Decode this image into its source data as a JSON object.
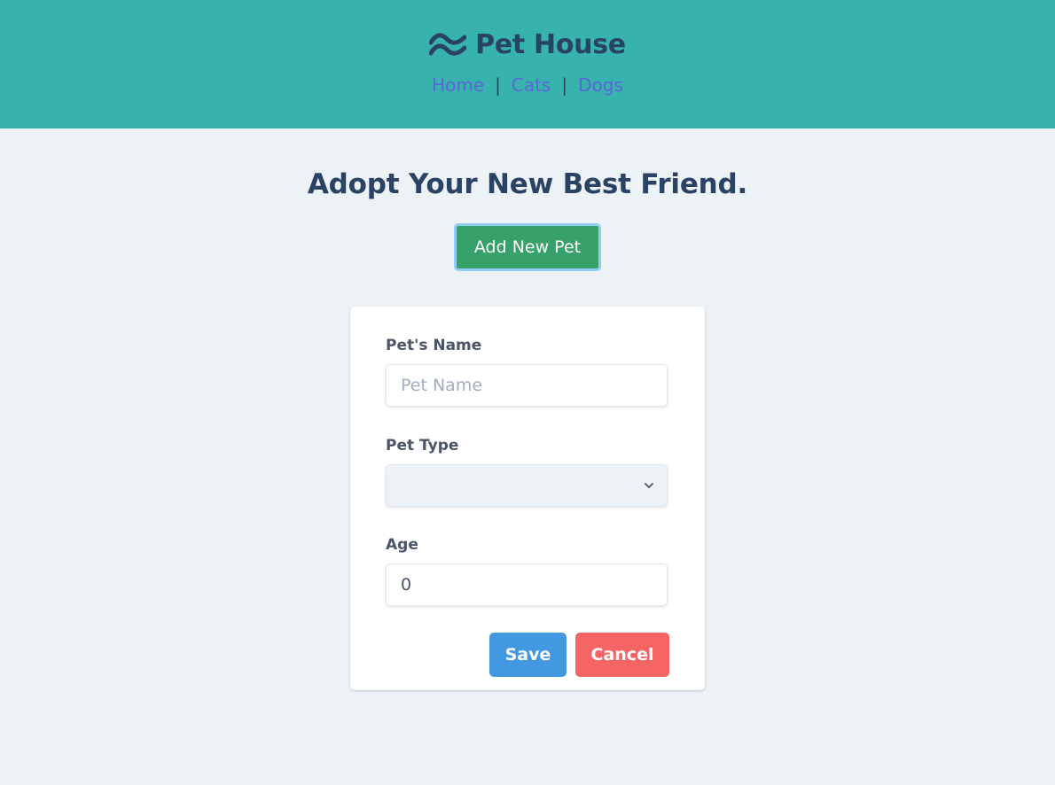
{
  "header": {
    "title": "Pet House",
    "icon": "tailwind-wave-icon",
    "nav": {
      "home": "Home",
      "cats": "Cats",
      "dogs": "Dogs",
      "separator": "|"
    }
  },
  "main": {
    "heading": "Adopt Your New Best Friend.",
    "add_button": "Add New Pet"
  },
  "form": {
    "name_label": "Pet's Name",
    "name_placeholder": "Pet Name",
    "name_value": "",
    "type_label": "Pet Type",
    "type_value": "",
    "age_label": "Age",
    "age_value": "0",
    "save_label": "Save",
    "cancel_label": "Cancel"
  },
  "colors": {
    "header_bg": "#38b2ac",
    "page_bg": "#edf2f7",
    "title_text": "#2a4365",
    "nav_link": "#5a67d8",
    "add_button": "#38a169",
    "save_button": "#4299e1",
    "cancel_button": "#f56565"
  }
}
